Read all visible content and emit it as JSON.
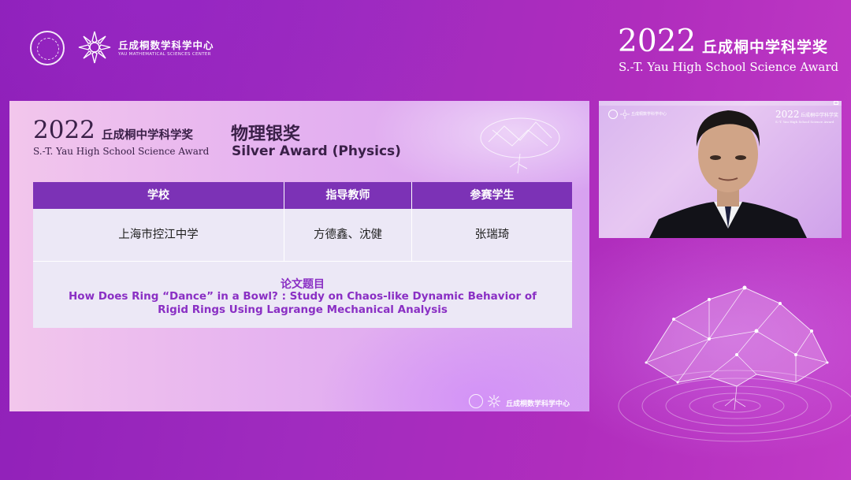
{
  "header": {
    "center_name": "丘成桐数学科学中心",
    "center_name_en": "YAU MATHEMATICAL SCIENCES CENTER",
    "award_year": "2022",
    "award_name_cn": "丘成桐中学科学奖",
    "award_name_en": "S.-T. Yau High School Science Award"
  },
  "slide": {
    "year": "2022",
    "award_name_cn": "丘成桐中学科学奖",
    "award_name_en": "S.-T. Yau High School Science Award",
    "prize_cn": "物理银奖",
    "prize_en": "Silver Award (Physics)",
    "table": {
      "headers": [
        "学校",
        "指导教师",
        "参赛学生"
      ],
      "row": [
        "上海市控江中学",
        "方德鑫、沈健",
        "张瑞琦"
      ]
    },
    "paper_label": "论文题目",
    "paper_title_line1": "How Does Ring “Dance” in a Bowl? : Study on Chaos-like Dynamic Behavior of",
    "paper_title_line2": "Rigid Rings Using Lagrange Mechanical Analysis",
    "footer_text": "丘成桐数学科学中心"
  },
  "camera": {
    "header_year": "2022",
    "header_award_cn": "丘成桐中学科学奖",
    "header_award_en": "S.-T. Yau High School Science Award",
    "logo_text": "丘成桐数学科学中心"
  },
  "colors": {
    "background": "#a02bbf",
    "table_header": "#7c32b6",
    "paper_title": "#8a2fc4"
  },
  "icons": [
    "tsinghua-seal-icon",
    "ymsc-flower-icon",
    "crystal-tree-icon"
  ]
}
